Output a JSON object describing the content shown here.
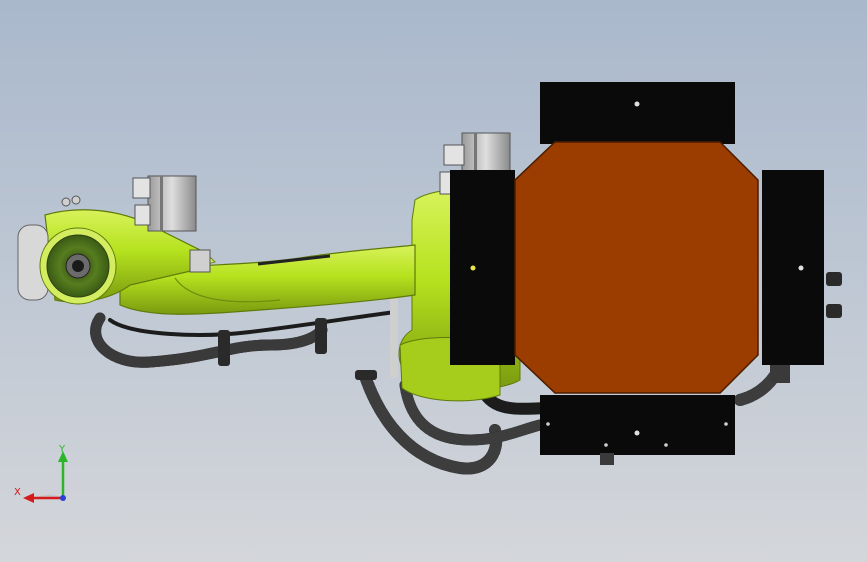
{
  "scene": {
    "model_colors": {
      "arm_green": "#b5e21e",
      "arm_shadow": "#86a814",
      "plate_orange": "#9b3c00",
      "block_black": "#0a0a0a",
      "cable_black": "#1c1c1c",
      "motor_grey": "#c8c8c8",
      "disc_green": "#4f7a1a"
    }
  },
  "triad": {
    "x_label": "X",
    "y_label": "Y",
    "x_color": "#d41a1a",
    "y_color": "#2bb52b",
    "z_color": "#2a3fd4"
  }
}
